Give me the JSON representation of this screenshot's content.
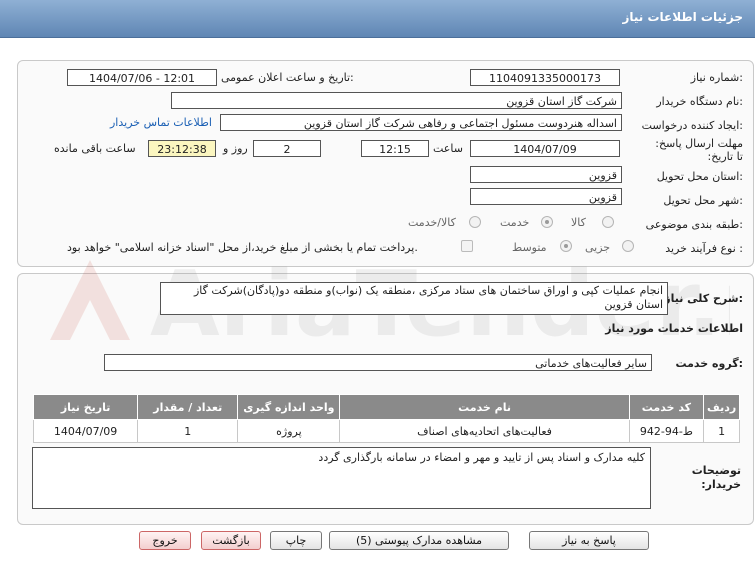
{
  "header": {
    "title": "جزئیات اطلاعات نیاز"
  },
  "labels": {
    "need_number": "شماره نیاز:",
    "announce_datetime": "تاریخ و ساعت اعلان عمومی:",
    "buyer_org": "نام دستگاه خریدار:",
    "requester": "ایجاد کننده درخواست:",
    "deadline": "مهلت ارسال پاسخ: تا تاریخ:",
    "time": "ساعت",
    "day_and": "روز و",
    "remaining": "ساعت باقی مانده",
    "province": "استان محل تحویل:",
    "city": "شهر محل تحویل:",
    "category": "طبقه بندی موضوعی:",
    "process_type": "نوع فرآیند خرید :",
    "general_desc": "شرح کلی نیاز:",
    "services_info": "اطلاعات خدمات مورد نیاز",
    "service_group": "گروه خدمت:",
    "buyer_notes": "توضیحات خریدار:"
  },
  "values": {
    "need_number": "1104091335000173",
    "announce_datetime": "1404/07/06 - 12:01",
    "buyer_org": "شرکت گاز استان قزوین",
    "requester": "اسداله هنردوست مسئول اجتماعی و رفاهی شرکت گاز استان قزوین",
    "contact_link": "اطلاعات تماس خریدار",
    "deadline_date": "1404/07/09",
    "deadline_time": "12:15",
    "days": "2",
    "remaining_time": "23:12:38",
    "province": "قزوین",
    "city": "قزوین",
    "general_desc": "انجام عملیات کپی و اوراق ساختمان های ستاد مرکزی ،منطقه یک (نواب)و منطقه دو(پادگان)شرکت گاز استان قزوین",
    "service_group": "سایر فعالیت‌های خدماتی",
    "buyer_notes": "کلیه مدارک و اسناد پس از تایید و مهر و امضاء در سامانه بارگذاری گردد"
  },
  "category_options": {
    "goods": "کالا",
    "service": "خدمت",
    "goods_service": "کالا/خدمت",
    "selected": "خدمت"
  },
  "process_options": {
    "partial": "جزیی",
    "medium": "متوسط",
    "selected": "متوسط",
    "payment_note": "پرداخت تمام یا بخشی از مبلغ خرید،از محل \"اسناد خزانه اسلامی\" خواهد بود."
  },
  "services_table": {
    "headers": [
      "ردیف",
      "کد خدمت",
      "نام خدمت",
      "واحد اندازه گیری",
      "تعداد / مقدار",
      "تاریخ نیاز"
    ],
    "rows": [
      [
        "1",
        "ط-94-942",
        "فعالیت‌های اتحادیه‌های اصناف",
        "پروژه",
        "1",
        "1404/07/09"
      ]
    ]
  },
  "buttons": {
    "reply": "پاسخ به نیاز",
    "attachments": "مشاهده مدارک پیوستی (5)",
    "print": "چاپ",
    "back": "بازگشت",
    "exit": "خروج"
  },
  "watermark": {
    "text": "AriaTender.net"
  },
  "colors": {
    "header": "#6f93bf",
    "link": "#1a5fb4",
    "remaining_bg": "#fbf6c0"
  }
}
